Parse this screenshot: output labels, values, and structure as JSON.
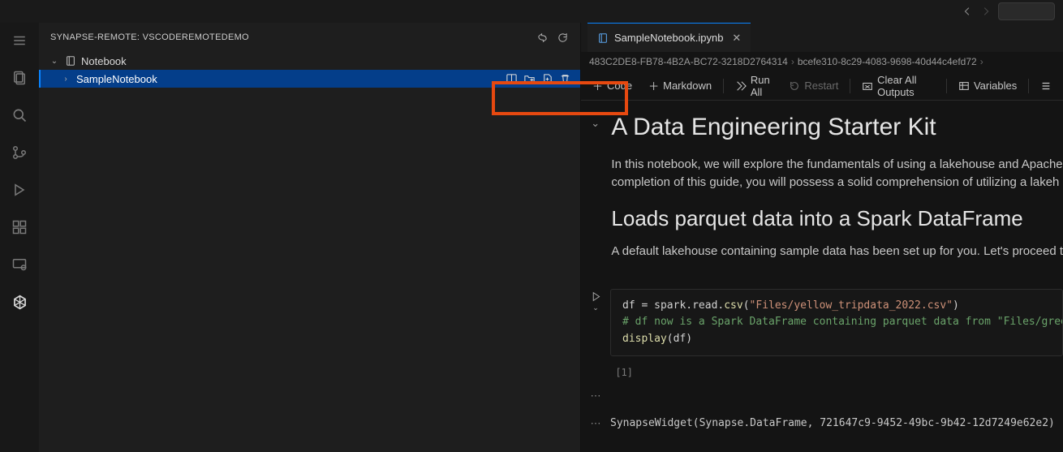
{
  "sidepanel": {
    "title": "SYNAPSE-REMOTE: VSCODEREMOTEDEMO",
    "tree": {
      "root": {
        "label": "Notebook"
      },
      "child": {
        "label": "SampleNotebook"
      }
    }
  },
  "editor": {
    "tab": {
      "label": "SampleNotebook.ipynb"
    },
    "breadcrumb": {
      "seg1": "483C2DE8-FB78-4B2A-BC72-3218D2764314",
      "seg2": "bcefe310-8c29-4083-9698-40d44c4efd72"
    },
    "toolbar": {
      "code": "Code",
      "markdown": "Markdown",
      "runall": "Run All",
      "restart": "Restart",
      "clear": "Clear All Outputs",
      "variables": "Variables"
    }
  },
  "notebook": {
    "md": {
      "h1": "A Data Engineering Starter Kit",
      "p1": "In this notebook, we will explore the fundamentals of using a lakehouse and Apache",
      "p2": "completion of this guide, you will possess a solid comprehension of utilizing a lakeh",
      "h2": "Loads parquet data into a Spark DataFrame",
      "p3": "A default lakehouse containing sample data has been set up for you. Let's proceed t"
    },
    "code": {
      "exec_label": "[1]",
      "line1a": "df = spark.read.",
      "line1b": "csv",
      "line1c": "(",
      "line1d": "\"Files/yellow_tripdata_2022.csv\"",
      "line1e": ")",
      "line2": "# df now is a Spark DataFrame containing parquet data from \"Files/green_",
      "line3a": "display",
      "line3b": "(df)"
    },
    "output": {
      "text": "SynapseWidget(Synapse.DataFrame, 721647c9-9452-49bc-9b42-12d7249e62e2)"
    }
  }
}
